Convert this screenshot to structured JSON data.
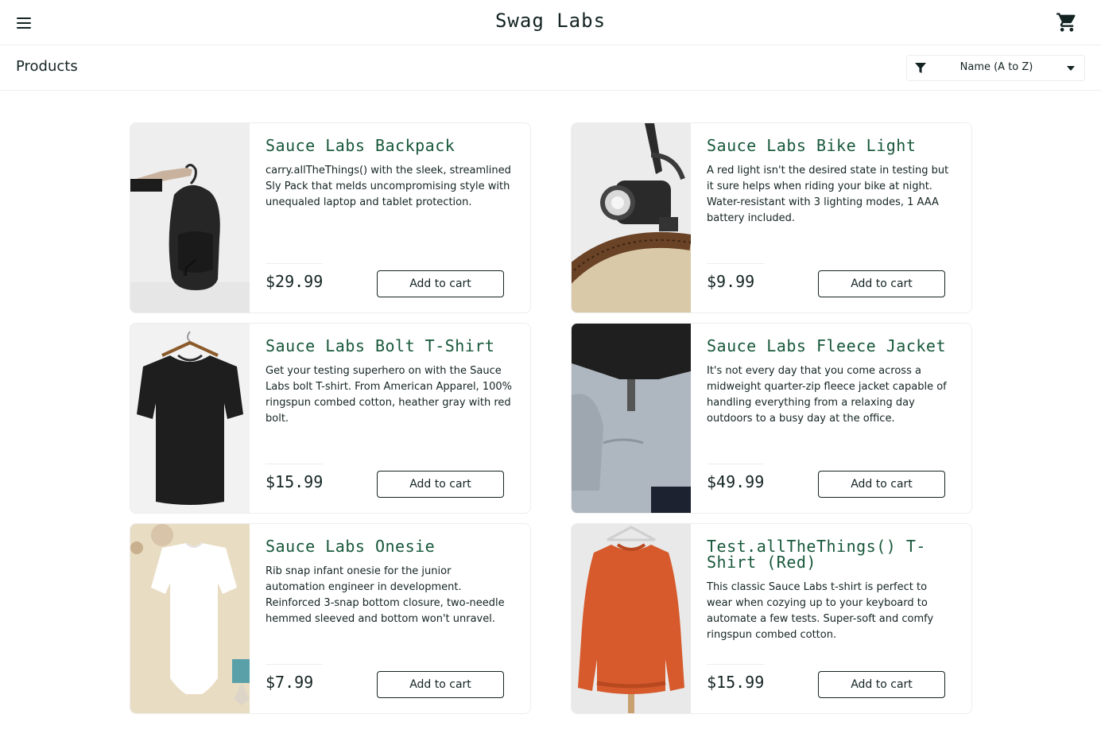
{
  "header": {
    "app_title": "Swag Labs",
    "menu_icon": "hamburger-menu-icon",
    "cart_icon": "shopping-cart-icon"
  },
  "subheader": {
    "title": "Products",
    "sort": {
      "icon": "filter-icon",
      "selected": "Name (A to Z)"
    }
  },
  "colors": {
    "accent_green": "#18583a",
    "text_dark": "#132322",
    "border": "#ededed"
  },
  "products": [
    {
      "name": "Sauce Labs Backpack",
      "description": "carry.allTheThings() with the sleek, streamlined Sly Pack that melds uncompromising style with unequaled laptop and tablet protection.",
      "price": "$29.99",
      "button": "Add to cart",
      "image": "black-backpack"
    },
    {
      "name": "Sauce Labs Bike Light",
      "description": "A red light isn't the desired state in testing but it sure helps when riding your bike at night. Water-resistant with 3 lighting modes, 1 AAA battery included.",
      "price": "$9.99",
      "button": "Add to cart",
      "image": "bike-light"
    },
    {
      "name": "Sauce Labs Bolt T-Shirt",
      "description": "Get your testing superhero on with the Sauce Labs bolt T-shirt. From American Apparel, 100% ringspun combed cotton, heather gray with red bolt.",
      "price": "$15.99",
      "button": "Add to cart",
      "image": "black-tshirt"
    },
    {
      "name": "Sauce Labs Fleece Jacket",
      "description": "It's not every day that you come across a midweight quarter-zip fleece jacket capable of handling everything from a relaxing day outdoors to a busy day at the office.",
      "price": "$49.99",
      "button": "Add to cart",
      "image": "fleece-jacket"
    },
    {
      "name": "Sauce Labs Onesie",
      "description": "Rib snap infant onesie for the junior automation engineer in development. Reinforced 3-snap bottom closure, two-needle hemmed sleeved and bottom won't unravel.",
      "price": "$7.99",
      "button": "Add to cart",
      "image": "white-onesie"
    },
    {
      "name": "Test.allTheThings() T-Shirt (Red)",
      "description": "This classic Sauce Labs t-shirt is perfect to wear when cozying up to your keyboard to automate a few tests. Super-soft and comfy ringspun combed cotton.",
      "price": "$15.99",
      "button": "Add to cart",
      "image": "red-sweatshirt"
    }
  ]
}
